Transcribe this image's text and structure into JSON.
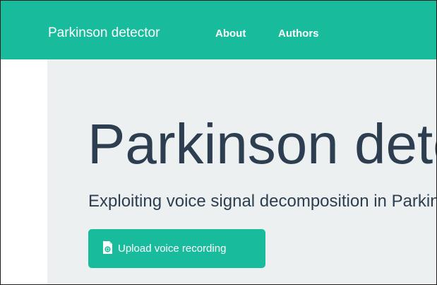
{
  "navbar": {
    "brand": "Parkinson detector",
    "links": [
      {
        "label": "About"
      },
      {
        "label": "Authors"
      }
    ],
    "background_color": "#18bc9c"
  },
  "hero": {
    "title": "Parkinson detector",
    "subtitle": "Exploiting voice signal decomposition in Parkinson's disease detection",
    "background_color": "#ecf0f1",
    "text_color": "#2c3e50"
  },
  "upload_button": {
    "label": "Upload voice recording",
    "icon": "file-audio-icon",
    "color": "#18bc9c"
  }
}
